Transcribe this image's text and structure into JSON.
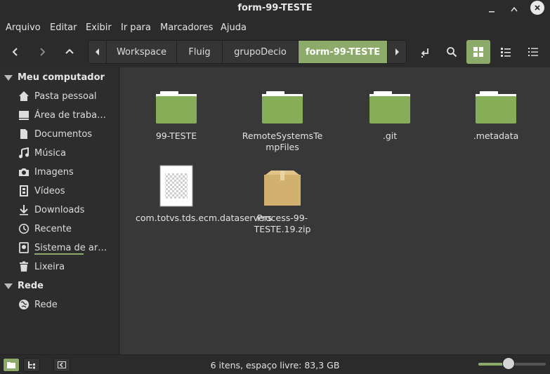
{
  "window": {
    "title": "form-99-TESTE"
  },
  "menu": [
    "Arquivo",
    "Editar",
    "Exibir",
    "Ir para",
    "Marcadores",
    "Ajuda"
  ],
  "path": [
    "Workspace",
    "Fluig",
    "grupoDecio",
    "form-99-TESTE"
  ],
  "sidebar": {
    "computer_heading": "Meu computador",
    "places": [
      {
        "label": "Pasta pessoal",
        "icon": "home-icon"
      },
      {
        "label": "Área de traba…",
        "icon": "desktop-icon"
      },
      {
        "label": "Documentos",
        "icon": "document-icon"
      },
      {
        "label": "Música",
        "icon": "music-icon"
      },
      {
        "label": "Imagens",
        "icon": "camera-icon"
      },
      {
        "label": "Vídeos",
        "icon": "film-icon"
      },
      {
        "label": "Downloads",
        "icon": "download-icon"
      },
      {
        "label": "Recente",
        "icon": "clock-icon"
      },
      {
        "label": "Sistema de ar…",
        "icon": "drive-icon"
      },
      {
        "label": "Lixeira",
        "icon": "trash-icon"
      }
    ],
    "network_heading": "Rede",
    "network": [
      {
        "label": "Rede",
        "icon": "network-icon"
      }
    ]
  },
  "files": [
    {
      "name": "99-TESTE",
      "type": "folder"
    },
    {
      "name": "RemoteSystemsTempFiles",
      "type": "folder"
    },
    {
      "name": ".git",
      "type": "folder"
    },
    {
      "name": ".metadata",
      "type": "folder"
    },
    {
      "name": "com.totvs.tds.ecm.dataservers",
      "type": "file"
    },
    {
      "name": "Process-99-TESTE.19.zip",
      "type": "archive"
    }
  ],
  "status": {
    "text": "6 itens, espaço livre: 83,3 GB",
    "zoom_level": 0.45
  },
  "colors": {
    "accent": "#8cab6a",
    "folder": "#86ad58",
    "archive": "#d2b06e"
  }
}
